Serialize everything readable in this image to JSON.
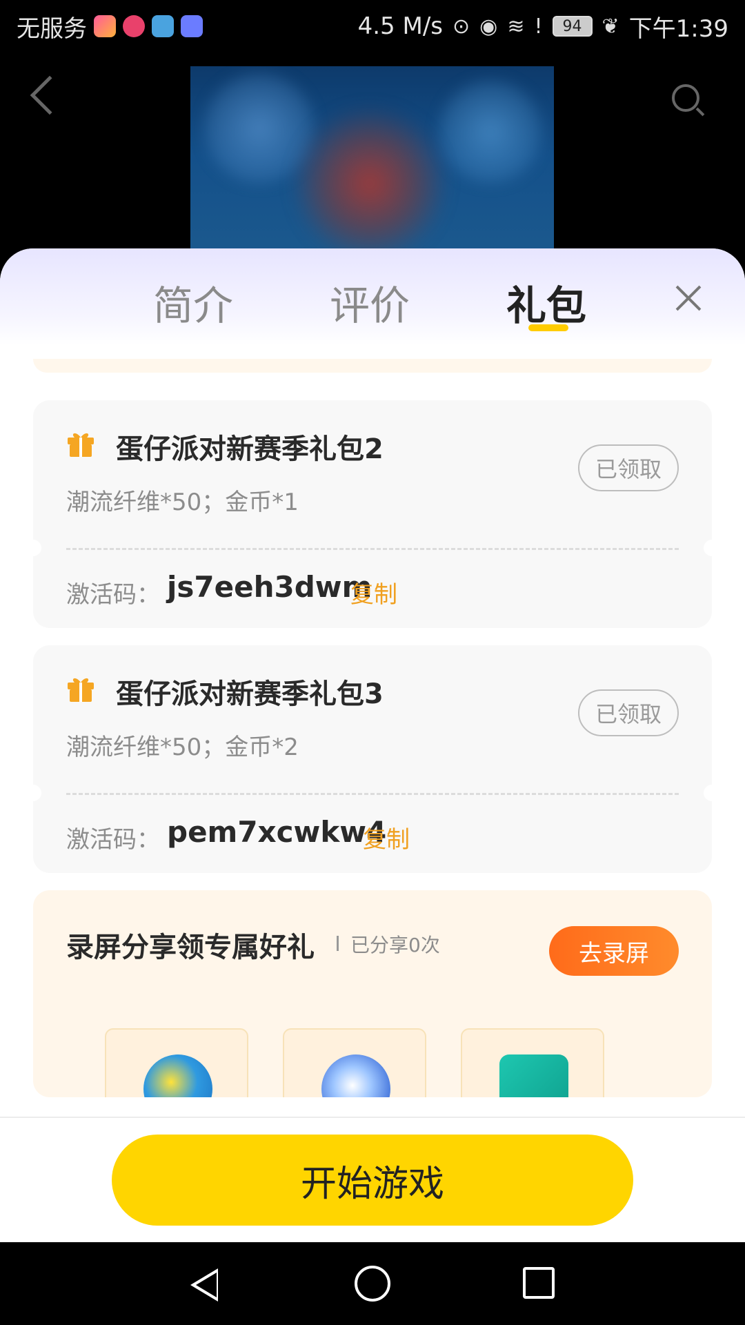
{
  "status_bar": {
    "carrier": "无服务",
    "speed": "4.5 M/s",
    "battery": "94",
    "time": "下午1:39"
  },
  "tabs": [
    {
      "label": "简介"
    },
    {
      "label": "评价"
    },
    {
      "label": "礼包"
    }
  ],
  "active_tab": "礼包",
  "gift_packs": [
    {
      "title": "蛋仔派对新赛季礼包2",
      "desc": "潮流纤维*50；金币*1",
      "status": "已领取",
      "code_label": "激活码：",
      "code": "js7eeh3dwm",
      "copy_label": "复制"
    },
    {
      "title": "蛋仔派对新赛季礼包3",
      "desc": "潮流纤维*50；金币*2",
      "status": "已领取",
      "code_label": "激活码：",
      "code": "pem7xcwkw4",
      "copy_label": "复制"
    }
  ],
  "share": {
    "title": "录屏分享领专属好礼",
    "count": "已分享0次",
    "button": "去录屏"
  },
  "start_button": "开始游戏",
  "colors": {
    "accent_yellow": "#ffd500",
    "copy_orange": "#f0a020",
    "record_orange": "#ff6b1a"
  }
}
